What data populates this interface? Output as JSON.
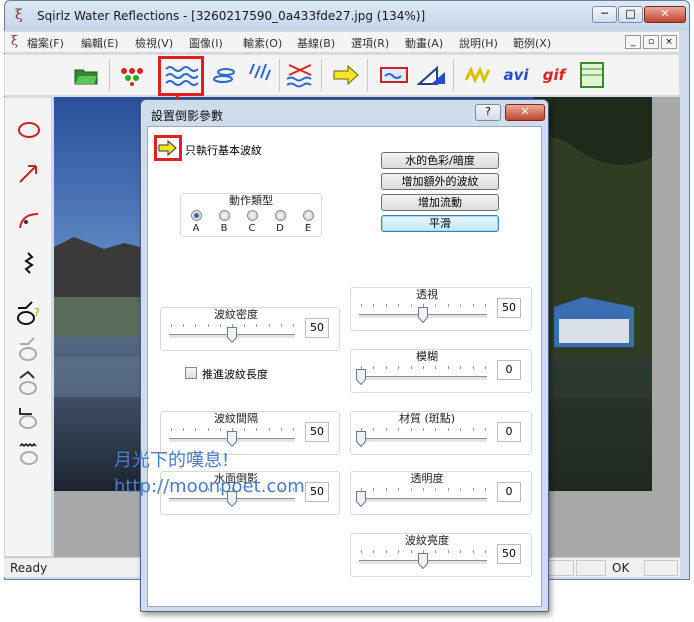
{
  "app": {
    "title": "Sqirlz Water Reflections - [3260217590_0a433fde27.jpg (134%)]",
    "icon": "sqirlz-logo-icon"
  },
  "window_controls": {
    "minimize": "─",
    "maximize": "□",
    "close": "✕"
  },
  "menu": [
    "檔案(F)",
    "編輯(E)",
    "檢視(V)",
    "圖像(I)",
    "輸素(O)",
    "基線(B)",
    "選項(R)",
    "動畫(A)",
    "說明(H)",
    "範例(X)"
  ],
  "mdi_controls": {
    "minimize": "_",
    "restore": "▫",
    "close": "×"
  },
  "toolbar": {
    "avi_label": "avi",
    "gif_label": "gif"
  },
  "status": {
    "left": "Ready",
    "right": "OK"
  },
  "dialog": {
    "title": "設置倒影參數",
    "help": "?",
    "close": "✕",
    "basic_waves_label": "只執行基本波紋",
    "buttons": {
      "water_color": "水的色彩/暗度",
      "extra_waves": "增加額外的波紋",
      "add_flow": "增加流動",
      "smooth": "平滑"
    },
    "action_type": {
      "label": "動作類型",
      "options": [
        "A",
        "B",
        "C",
        "D",
        "E"
      ],
      "selected": "A"
    },
    "advance_wave_length": {
      "label": "推進波紋長度",
      "checked": false
    },
    "sliders": {
      "wave_density": {
        "label": "波紋密度",
        "value": "50",
        "fraction": 0.5
      },
      "wave_spacing": {
        "label": "波紋間隔",
        "value": "50",
        "fraction": 0.5
      },
      "water_reflection": {
        "label": "水面倒影",
        "value": "50",
        "fraction": 0.5
      },
      "perspective": {
        "label": "透視",
        "value": "50",
        "fraction": 0.5
      },
      "blur": {
        "label": "模糊",
        "value": "0",
        "fraction": 0
      },
      "texture": {
        "label": "材質 (斑點)",
        "value": "0",
        "fraction": 0
      },
      "transparency": {
        "label": "透明度",
        "value": "0",
        "fraction": 0
      },
      "wave_brightness": {
        "label": "波紋亮度",
        "value": "50",
        "fraction": 0.5
      }
    }
  },
  "watermark": {
    "line1": "月光下的嘆息!",
    "line2": "http://moonpoet.com"
  },
  "colors": {
    "accent": "#3c7fb1",
    "highlight_box": "#e02020",
    "watermark": "#4b7cc9"
  }
}
